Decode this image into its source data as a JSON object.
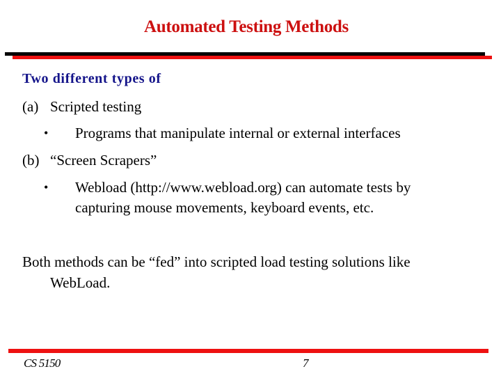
{
  "slide": {
    "title": "Automated Testing Methods",
    "heading": "Two different types of",
    "items": [
      {
        "label": "(a)",
        "text": "Scripted testing",
        "bullets": [
          {
            "symbol": "•",
            "lines": [
              "Programs that manipulate internal or external interfaces"
            ]
          }
        ]
      },
      {
        "label": "(b)",
        "text": "“Screen Scrapers”",
        "bullets": [
          {
            "symbol": "•",
            "lines": [
              "Webload (http://www.webload.org) can automate tests by",
              "capturing mouse movements, keyboard events, etc."
            ]
          }
        ]
      }
    ],
    "conclusion": [
      "Both methods can be “fed” into scripted load testing solutions like",
      "WebLoad."
    ]
  },
  "footer": {
    "course": "CS 5150",
    "page_number": "7"
  },
  "colors": {
    "title": "#cc1010",
    "heading": "#14148a",
    "rule_red": "#ee1111",
    "rule_black": "#000000"
  }
}
